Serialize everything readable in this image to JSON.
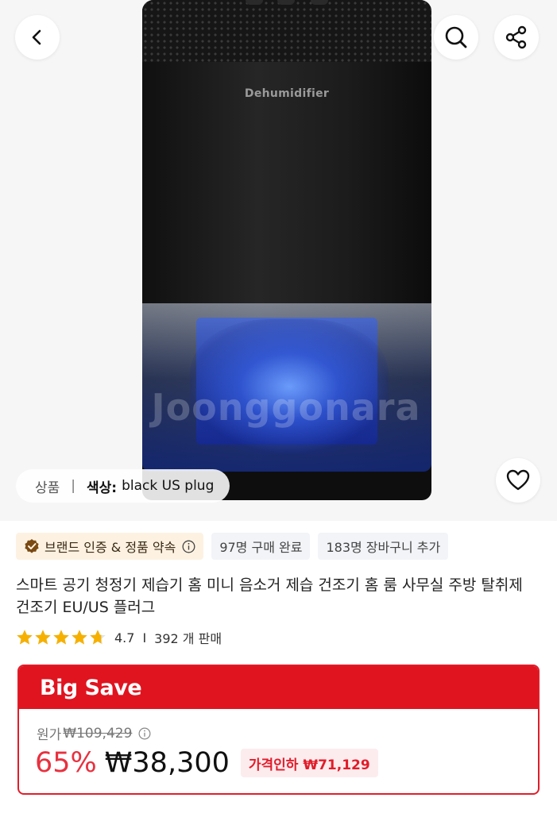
{
  "hero": {
    "product_print": "Dehumidifier",
    "watermark": "Joonggonara",
    "option": {
      "section": "상품",
      "separator": "|",
      "key": "색상:",
      "value": "black US plug"
    }
  },
  "nav_icons": {
    "back": "chevron-left-icon",
    "search": "search-icon",
    "share": "share-icon",
    "wishlist": "heart-icon"
  },
  "badges": {
    "brand": "브랜드 인증 & 정품 약속",
    "purchased": "97명 구매 완료",
    "cart": "183명 장바구니 추가"
  },
  "product": {
    "title": "스마트 공기 청정기 제습기 홈 미니 음소거 제습 건조기 홈 룸 사무실 주방 탈취제 건조기 EU/US 플러그"
  },
  "rating": {
    "score": "4.7",
    "stars_value": 4.7,
    "separator": "I",
    "sold": "392 개 판매"
  },
  "pricing": {
    "banner": "Big Save",
    "original_label": "원가",
    "original_price": "₩109,429",
    "discount": "65%",
    "sale_price": "₩38,300",
    "price_drop": "가격인하 ₩71,129"
  },
  "colors": {
    "accent_red": "#e0141f",
    "star_gold": "#f6b100",
    "brand_badge_bg": "#fdf2e2"
  }
}
